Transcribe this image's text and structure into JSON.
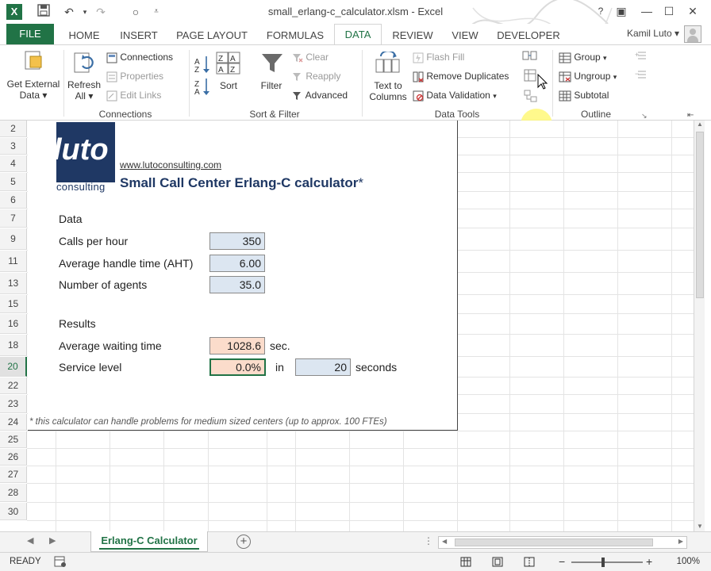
{
  "window": {
    "title": "small_erlang-c_calculator.xlsm - Excel",
    "app_icon": "X",
    "help": "?"
  },
  "tabs": [
    {
      "label": "FILE"
    },
    {
      "label": "HOME"
    },
    {
      "label": "INSERT"
    },
    {
      "label": "PAGE LAYOUT"
    },
    {
      "label": "FORMULAS"
    },
    {
      "label": "DATA"
    },
    {
      "label": "REVIEW"
    },
    {
      "label": "VIEW"
    },
    {
      "label": "DEVELOPER"
    }
  ],
  "user": "Kamil Luto",
  "ribbon": {
    "get_external": {
      "line1": "Get External",
      "line2": "Data"
    },
    "refresh": {
      "line1": "Refresh",
      "line2": "All"
    },
    "connections": "Connections",
    "properties": "Properties",
    "edit_links": "Edit Links",
    "group_connections": "Connections",
    "sort": "Sort",
    "filter": "Filter",
    "clear": "Clear",
    "reapply": "Reapply",
    "advanced": "Advanced",
    "group_sort": "Sort & Filter",
    "text_to_columns": {
      "line1": "Text to",
      "line2": "Columns"
    },
    "flash_fill": "Flash Fill",
    "remove_duplicates": "Remove Duplicates",
    "data_validation": "Data Validation",
    "group_tools": "Data Tools",
    "group": "Group",
    "ungroup": "Ungroup",
    "subtotal": "Subtotal",
    "group_outline": "Outline"
  },
  "rows": [
    "2",
    "3",
    "4",
    "5",
    "6",
    "7",
    "9",
    "11",
    "13",
    "15",
    "16",
    "18",
    "20",
    "22",
    "23",
    "24",
    "25",
    "26",
    "27",
    "28",
    "30"
  ],
  "calculator": {
    "logo_text": "luto",
    "logo_sub": "consulting",
    "url": "www.lutoconsulting.com",
    "title": "Small Call Center Erlang-C calculator",
    "title_star": "*",
    "data_heading": "Data",
    "calls_label": "Calls per hour",
    "calls_value": "350",
    "aht_label": "Average handle time (AHT)",
    "aht_value": "6.00",
    "agents_label": "Number of agents",
    "agents_value": "35.0",
    "results_heading": "Results",
    "awt_label": "Average waiting time",
    "awt_value": "1028.6",
    "awt_unit": "sec.",
    "sl_label": "Service level",
    "sl_value": "0.0%",
    "sl_in": "in",
    "sl_seconds_value": "20",
    "sl_seconds_unit": "seconds",
    "footnote": "* this calculator can handle problems for medium sized centers (up to approx. 100 FTEs)"
  },
  "sheet_tab": "Erlang-C Calculator",
  "status": {
    "ready": "READY",
    "zoom": "100%"
  }
}
